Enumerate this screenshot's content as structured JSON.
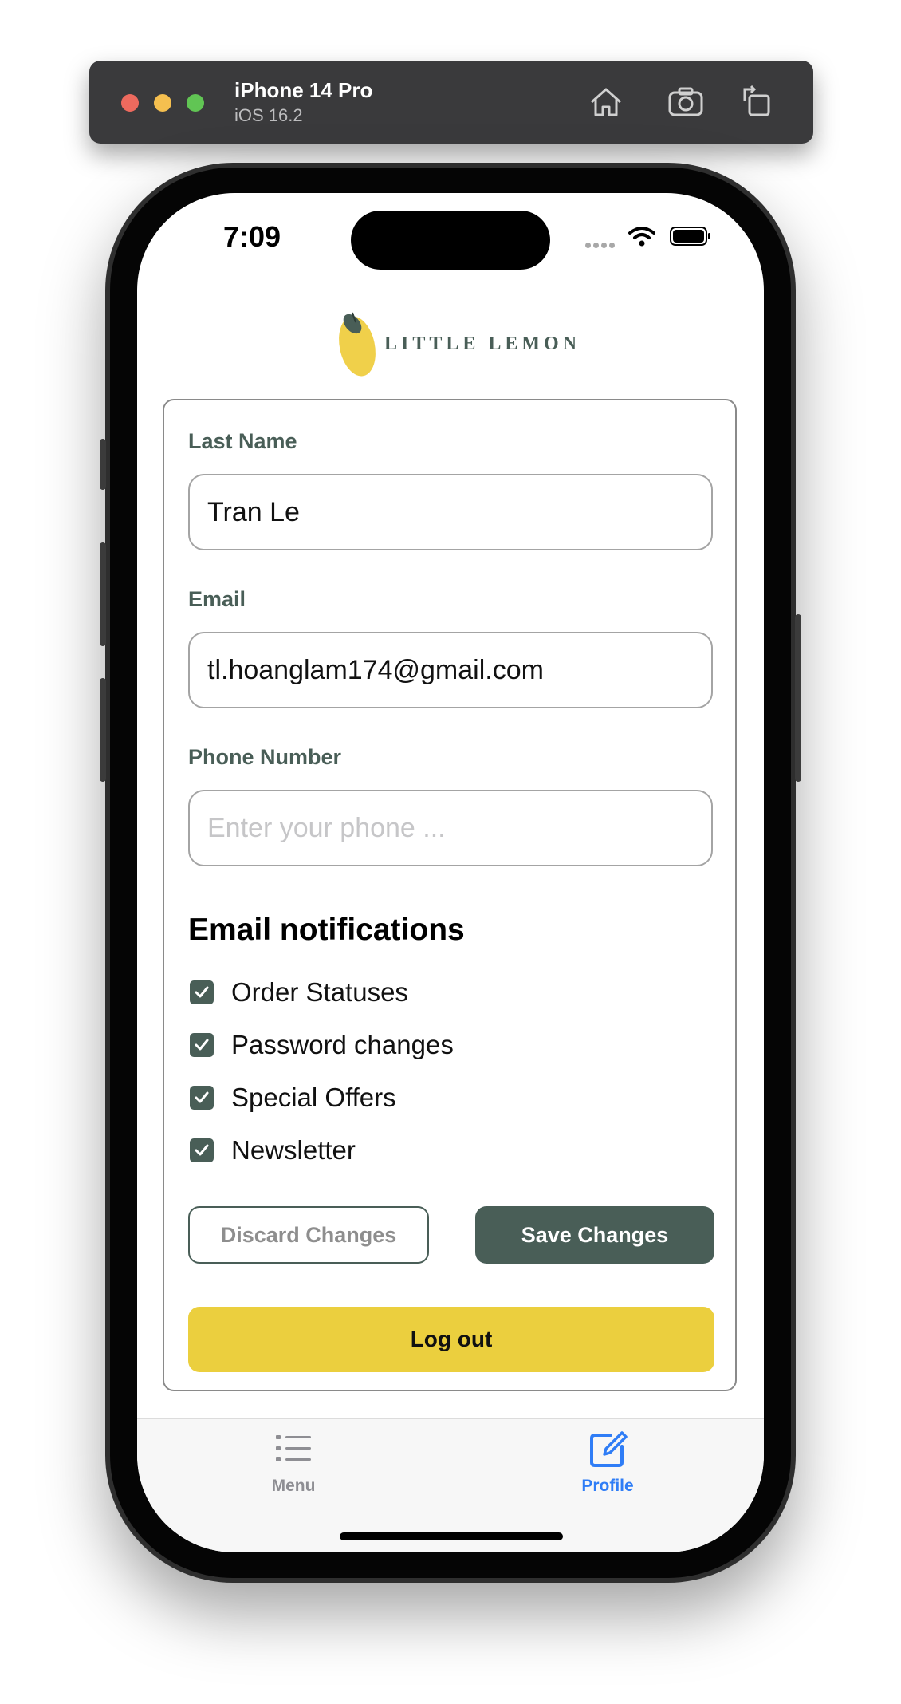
{
  "simulator": {
    "device_name": "iPhone 14 Pro",
    "os_version": "iOS 16.2",
    "icons": [
      "home-icon",
      "screenshot-icon",
      "rotate-icon"
    ]
  },
  "status_bar": {
    "time": "7:09"
  },
  "header": {
    "brand": "LITTLE LEMON"
  },
  "form": {
    "last_name": {
      "label": "Last Name",
      "value": "Tran Le"
    },
    "email": {
      "label": "Email",
      "value": "tl.hoanglam174@gmail.com"
    },
    "phone": {
      "label": "Phone Number",
      "placeholder": "Enter your phone ...",
      "value": ""
    }
  },
  "notifications": {
    "title": "Email notifications",
    "items": [
      {
        "label": "Order Statuses",
        "checked": true
      },
      {
        "label": "Password changes",
        "checked": true
      },
      {
        "label": "Special Offers",
        "checked": true
      },
      {
        "label": "Newsletter",
        "checked": true
      }
    ]
  },
  "buttons": {
    "discard": "Discard Changes",
    "save": "Save Changes",
    "logout": "Log out"
  },
  "tabbar": {
    "menu": "Menu",
    "profile": "Profile",
    "active": "Profile"
  },
  "colors": {
    "primary_green": "#495e57",
    "primary_yellow": "#ebcf3e",
    "tab_active": "#2f7df6"
  }
}
